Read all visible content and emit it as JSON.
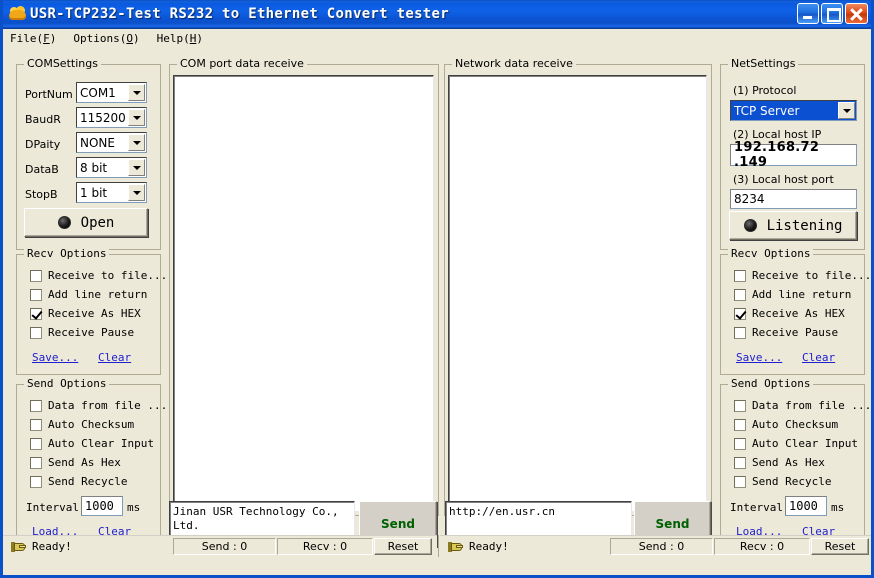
{
  "window": {
    "title": "USR-TCP232-Test  RS232 to Ethernet Convert tester",
    "icon": "cloud-app-icon",
    "minimize_label": "",
    "maximize_label": "",
    "close_label": "",
    "titlebar_color": "#0a50c8"
  },
  "menu": [
    {
      "label": "File",
      "accel": "F"
    },
    {
      "label": "Options",
      "accel": "O"
    },
    {
      "label": "Help",
      "accel": "H"
    }
  ],
  "com_settings": {
    "legend": "COMSettings",
    "fields": [
      {
        "label": "PortNum",
        "value": "COM1"
      },
      {
        "label": "BaudR",
        "value": "115200"
      },
      {
        "label": "DPaity",
        "value": "NONE"
      },
      {
        "label": "DataB",
        "value": "8 bit"
      },
      {
        "label": "StopB",
        "value": "1 bit"
      }
    ],
    "open_button": "Open"
  },
  "left_recv_options": {
    "legend": "Recv Options",
    "items": [
      {
        "label": "Receive to file...",
        "checked": false
      },
      {
        "label": "Add line return",
        "checked": false
      },
      {
        "label": "Receive As HEX",
        "checked": true
      },
      {
        "label": "Receive Pause",
        "checked": false
      }
    ],
    "save_link": "Save...",
    "clear_link": "Clear"
  },
  "left_send_options": {
    "legend": "Send Options",
    "items": [
      {
        "label": "Data from file ...",
        "checked": false
      },
      {
        "label": "Auto Checksum",
        "checked": false
      },
      {
        "label": "Auto Clear Input",
        "checked": false
      },
      {
        "label": "Send As Hex",
        "checked": false
      },
      {
        "label": "Send Recycle",
        "checked": false
      }
    ],
    "interval_label": "Interval",
    "interval_value": "1000",
    "interval_unit": "ms",
    "load_link": "Load...",
    "clear_link": "Clear"
  },
  "com_pane": {
    "legend": "COM port data receive",
    "content": ""
  },
  "net_pane": {
    "legend": "Network data receive",
    "content": ""
  },
  "com_send": {
    "value": "Jinan USR Technology Co., Ltd.",
    "button": "Send"
  },
  "net_send": {
    "value": "http://en.usr.cn",
    "button": "Send"
  },
  "net_settings": {
    "legend": "NetSettings",
    "protocol_label": "(1)  Protocol",
    "protocol_value": "TCP Server",
    "host_ip_label": "(2)  Local host IP",
    "host_ip_value": "192.168.72 .149",
    "host_port_label": "(3)  Local host port",
    "host_port_value": "8234",
    "listen_button": "Listening"
  },
  "right_recv_options": {
    "legend": "Recv Options",
    "items": [
      {
        "label": "Receive to file...",
        "checked": false
      },
      {
        "label": "Add line return",
        "checked": false
      },
      {
        "label": "Receive As HEX",
        "checked": true
      },
      {
        "label": "Receive Pause",
        "checked": false
      }
    ],
    "save_link": "Save...",
    "clear_link": "Clear"
  },
  "right_send_options": {
    "legend": "Send Options",
    "items": [
      {
        "label": "Data from file ...",
        "checked": false
      },
      {
        "label": "Auto Checksum",
        "checked": false
      },
      {
        "label": "Auto Clear Input",
        "checked": false
      },
      {
        "label": "Send As Hex",
        "checked": false
      },
      {
        "label": "Send Recycle",
        "checked": false
      }
    ],
    "interval_label": "Interval",
    "interval_value": "1000",
    "interval_unit": "ms",
    "load_link": "Load...",
    "clear_link": "Clear"
  },
  "status_left": {
    "ready": "Ready!",
    "send": "Send : 0",
    "recv": "Recv : 0",
    "reset": "Reset"
  },
  "status_right": {
    "ready": "Ready!",
    "send": "Send : 0",
    "recv": "Recv : 0",
    "reset": "Reset"
  }
}
